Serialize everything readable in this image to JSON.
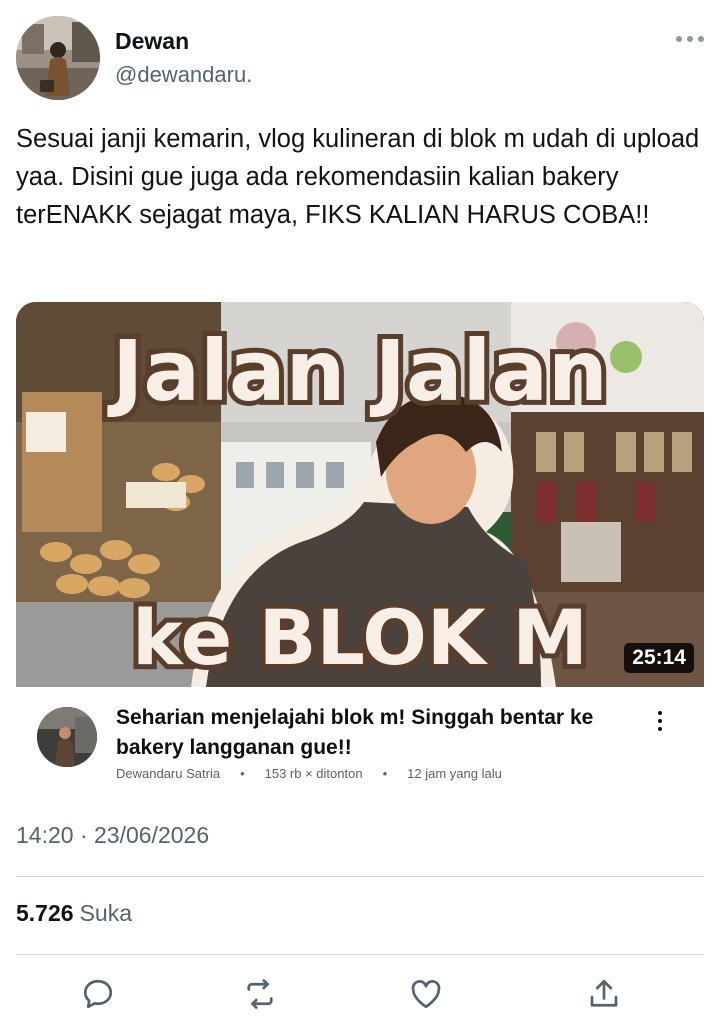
{
  "tweet": {
    "author": {
      "name": "Dewan",
      "handle": "@dewandaru."
    },
    "text": "Sesuai janji kemarin, vlog kulineran di blok m udah di upload yaa. Disini gue juga ada rekomendasiin kalian bakery terENAKK sejagat maya, FIKS KALIAN HARUS COBA!!",
    "timestamp": "14:20 · 23/06/2026",
    "likes": {
      "count": "5.726",
      "label": "Suka"
    }
  },
  "video": {
    "thumbnail_text": {
      "line1": "Jalan Jalan",
      "line2": "ke BLOK M"
    },
    "duration": "25:14",
    "title": "Seharian menjelajahi blok m! Singgah bentar ke bakery langganan gue!!",
    "channel": "Dewandaru Satria",
    "views": "153 rb × ditonton",
    "age": "12 jam yang lalu"
  },
  "actions": [
    {
      "name": "reply-icon"
    },
    {
      "name": "retweet-icon"
    },
    {
      "name": "like-icon"
    },
    {
      "name": "share-icon"
    }
  ],
  "colors": {
    "text_primary": "#0f1419",
    "text_secondary": "#536471",
    "divider": "#cfd9de",
    "action_icon": "#536471"
  }
}
